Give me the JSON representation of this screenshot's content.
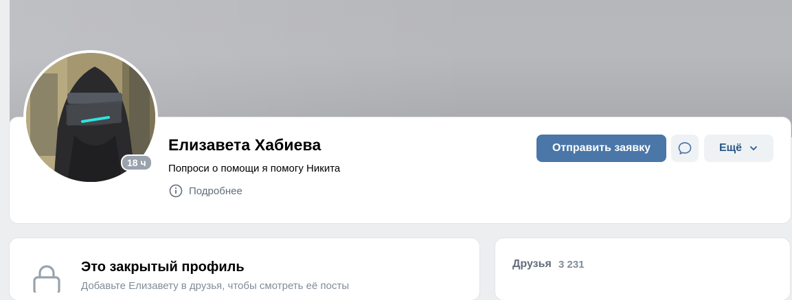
{
  "profile": {
    "name": "Елизавета Хабиева",
    "status": "Попроси о помощи я помогу Никита",
    "last_seen_badge": "18 ч",
    "more_info_label": "Подробнее"
  },
  "actions": {
    "send_request_label": "Отправить заявку",
    "message_icon": "chat-bubble-icon",
    "more_label": "Ещё"
  },
  "closed_profile": {
    "title": "Это закрытый профиль",
    "subtitle": "Добавьте Елизавету в друзья, чтобы смотреть её посты"
  },
  "friends": {
    "label": "Друзья",
    "count": "3 231"
  },
  "colors": {
    "primary": "#4a76a8",
    "background": "#edeef0",
    "secondary_button": "#eff2f5",
    "link": "#2a5885"
  }
}
